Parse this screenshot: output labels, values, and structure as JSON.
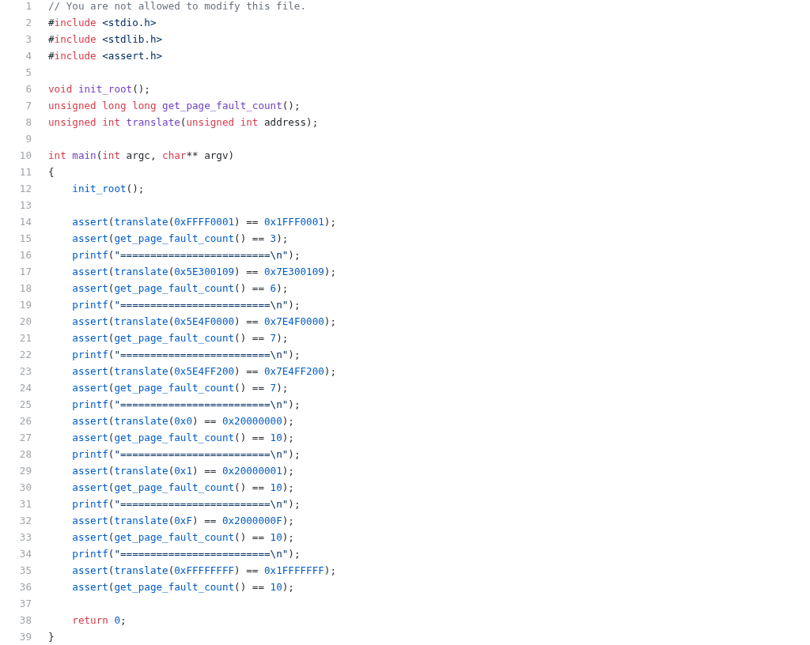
{
  "code_view": {
    "lines": [
      {
        "number": "1",
        "indented": false,
        "tokens": [
          {
            "kind": "comment",
            "text": "// You are not allowed to modify this file."
          }
        ]
      },
      {
        "number": "2",
        "indented": false,
        "tokens": [
          {
            "kind": "plain",
            "text": "#"
          },
          {
            "kind": "keyword",
            "text": "include"
          },
          {
            "kind": "string",
            "text": " <stdio.h>"
          }
        ]
      },
      {
        "number": "3",
        "indented": false,
        "tokens": [
          {
            "kind": "plain",
            "text": "#"
          },
          {
            "kind": "keyword",
            "text": "include"
          },
          {
            "kind": "string",
            "text": " <stdlib.h>"
          }
        ]
      },
      {
        "number": "4",
        "indented": false,
        "tokens": [
          {
            "kind": "plain",
            "text": "#"
          },
          {
            "kind": "keyword",
            "text": "include"
          },
          {
            "kind": "string",
            "text": " <assert.h>"
          }
        ]
      },
      {
        "number": "5"
      },
      {
        "number": "6",
        "indented": false,
        "tokens": [
          {
            "kind": "keyword",
            "text": "void"
          },
          {
            "kind": "function",
            "text": " init_root"
          },
          {
            "kind": "plain",
            "text": "();"
          }
        ]
      },
      {
        "number": "7",
        "indented": false,
        "tokens": [
          {
            "kind": "keyword",
            "text": "unsigned long long"
          },
          {
            "kind": "function",
            "text": " get_page_fault_count"
          },
          {
            "kind": "plain",
            "text": "();"
          }
        ]
      },
      {
        "number": "8",
        "indented": false,
        "tokens": [
          {
            "kind": "keyword",
            "text": "unsigned int"
          },
          {
            "kind": "function",
            "text": " translate"
          },
          {
            "kind": "plain",
            "text": "("
          },
          {
            "kind": "keyword",
            "text": "unsigned int"
          },
          {
            "kind": "plain",
            "text": " address);"
          }
        ]
      },
      {
        "number": "9"
      },
      {
        "number": "10",
        "indented": false,
        "tokens": [
          {
            "kind": "keyword",
            "text": "int"
          },
          {
            "kind": "function",
            "text": " main"
          },
          {
            "kind": "plain",
            "text": "("
          },
          {
            "kind": "keyword",
            "text": "int"
          },
          {
            "kind": "plain",
            "text": " argc, "
          },
          {
            "kind": "keyword",
            "text": "char"
          },
          {
            "kind": "plain",
            "text": "** argv)"
          }
        ]
      },
      {
        "number": "11",
        "indented": false,
        "tokens": [
          {
            "kind": "plain",
            "text": "{"
          }
        ]
      },
      {
        "number": "12",
        "indented": true,
        "tokens": [
          {
            "kind": "call",
            "text": "init_root"
          },
          {
            "kind": "plain",
            "text": "();"
          }
        ]
      },
      {
        "number": "13"
      },
      {
        "number": "14",
        "indented": true,
        "tokens": [
          {
            "kind": "call",
            "text": "assert"
          },
          {
            "kind": "plain",
            "text": "("
          },
          {
            "kind": "call",
            "text": "translate"
          },
          {
            "kind": "plain",
            "text": "("
          },
          {
            "kind": "number",
            "text": "0xFFFF0001"
          },
          {
            "kind": "plain",
            "text": ") == "
          },
          {
            "kind": "number",
            "text": "0x1FFF0001"
          },
          {
            "kind": "plain",
            "text": ");"
          }
        ]
      },
      {
        "number": "15",
        "indented": true,
        "tokens": [
          {
            "kind": "call",
            "text": "assert"
          },
          {
            "kind": "plain",
            "text": "("
          },
          {
            "kind": "call",
            "text": "get_page_fault_count"
          },
          {
            "kind": "plain",
            "text": "() == "
          },
          {
            "kind": "number",
            "text": "3"
          },
          {
            "kind": "plain",
            "text": ");"
          }
        ]
      },
      {
        "number": "16",
        "indented": true,
        "tokens": [
          {
            "kind": "call",
            "text": "printf"
          },
          {
            "kind": "plain",
            "text": "("
          },
          {
            "kind": "string",
            "text": "\"=========================\\n\""
          },
          {
            "kind": "plain",
            "text": ");"
          }
        ]
      },
      {
        "number": "17",
        "indented": true,
        "tokens": [
          {
            "kind": "call",
            "text": "assert"
          },
          {
            "kind": "plain",
            "text": "("
          },
          {
            "kind": "call",
            "text": "translate"
          },
          {
            "kind": "plain",
            "text": "("
          },
          {
            "kind": "number",
            "text": "0x5E300109"
          },
          {
            "kind": "plain",
            "text": ") == "
          },
          {
            "kind": "number",
            "text": "0x7E300109"
          },
          {
            "kind": "plain",
            "text": ");"
          }
        ]
      },
      {
        "number": "18",
        "indented": true,
        "tokens": [
          {
            "kind": "call",
            "text": "assert"
          },
          {
            "kind": "plain",
            "text": "("
          },
          {
            "kind": "call",
            "text": "get_page_fault_count"
          },
          {
            "kind": "plain",
            "text": "() == "
          },
          {
            "kind": "number",
            "text": "6"
          },
          {
            "kind": "plain",
            "text": ");"
          }
        ]
      },
      {
        "number": "19",
        "indented": true,
        "tokens": [
          {
            "kind": "call",
            "text": "printf"
          },
          {
            "kind": "plain",
            "text": "("
          },
          {
            "kind": "string",
            "text": "\"=========================\\n\""
          },
          {
            "kind": "plain",
            "text": ");"
          }
        ]
      },
      {
        "number": "20",
        "indented": true,
        "tokens": [
          {
            "kind": "call",
            "text": "assert"
          },
          {
            "kind": "plain",
            "text": "("
          },
          {
            "kind": "call",
            "text": "translate"
          },
          {
            "kind": "plain",
            "text": "("
          },
          {
            "kind": "number",
            "text": "0x5E4F0000"
          },
          {
            "kind": "plain",
            "text": ") == "
          },
          {
            "kind": "number",
            "text": "0x7E4F0000"
          },
          {
            "kind": "plain",
            "text": ");"
          }
        ]
      },
      {
        "number": "21",
        "indented": true,
        "tokens": [
          {
            "kind": "call",
            "text": "assert"
          },
          {
            "kind": "plain",
            "text": "("
          },
          {
            "kind": "call",
            "text": "get_page_fault_count"
          },
          {
            "kind": "plain",
            "text": "() == "
          },
          {
            "kind": "number",
            "text": "7"
          },
          {
            "kind": "plain",
            "text": ");"
          }
        ]
      },
      {
        "number": "22",
        "indented": true,
        "tokens": [
          {
            "kind": "call",
            "text": "printf"
          },
          {
            "kind": "plain",
            "text": "("
          },
          {
            "kind": "string",
            "text": "\"=========================\\n\""
          },
          {
            "kind": "plain",
            "text": ");"
          }
        ]
      },
      {
        "number": "23",
        "indented": true,
        "tokens": [
          {
            "kind": "call",
            "text": "assert"
          },
          {
            "kind": "plain",
            "text": "("
          },
          {
            "kind": "call",
            "text": "translate"
          },
          {
            "kind": "plain",
            "text": "("
          },
          {
            "kind": "number",
            "text": "0x5E4FF200"
          },
          {
            "kind": "plain",
            "text": ") == "
          },
          {
            "kind": "number",
            "text": "0x7E4FF200"
          },
          {
            "kind": "plain",
            "text": ");"
          }
        ]
      },
      {
        "number": "24",
        "indented": true,
        "tokens": [
          {
            "kind": "call",
            "text": "assert"
          },
          {
            "kind": "plain",
            "text": "("
          },
          {
            "kind": "call",
            "text": "get_page_fault_count"
          },
          {
            "kind": "plain",
            "text": "() == "
          },
          {
            "kind": "number",
            "text": "7"
          },
          {
            "kind": "plain",
            "text": ");"
          }
        ]
      },
      {
        "number": "25",
        "indented": true,
        "tokens": [
          {
            "kind": "call",
            "text": "printf"
          },
          {
            "kind": "plain",
            "text": "("
          },
          {
            "kind": "string",
            "text": "\"=========================\\n\""
          },
          {
            "kind": "plain",
            "text": ");"
          }
        ]
      },
      {
        "number": "26",
        "indented": true,
        "tokens": [
          {
            "kind": "call",
            "text": "assert"
          },
          {
            "kind": "plain",
            "text": "("
          },
          {
            "kind": "call",
            "text": "translate"
          },
          {
            "kind": "plain",
            "text": "("
          },
          {
            "kind": "number",
            "text": "0x0"
          },
          {
            "kind": "plain",
            "text": ") == "
          },
          {
            "kind": "number",
            "text": "0x20000000"
          },
          {
            "kind": "plain",
            "text": ");"
          }
        ]
      },
      {
        "number": "27",
        "indented": true,
        "tokens": [
          {
            "kind": "call",
            "text": "assert"
          },
          {
            "kind": "plain",
            "text": "("
          },
          {
            "kind": "call",
            "text": "get_page_fault_count"
          },
          {
            "kind": "plain",
            "text": "() == "
          },
          {
            "kind": "number",
            "text": "10"
          },
          {
            "kind": "plain",
            "text": ");"
          }
        ]
      },
      {
        "number": "28",
        "indented": true,
        "tokens": [
          {
            "kind": "call",
            "text": "printf"
          },
          {
            "kind": "plain",
            "text": "("
          },
          {
            "kind": "string",
            "text": "\"=========================\\n\""
          },
          {
            "kind": "plain",
            "text": ");"
          }
        ]
      },
      {
        "number": "29",
        "indented": true,
        "tokens": [
          {
            "kind": "call",
            "text": "assert"
          },
          {
            "kind": "plain",
            "text": "("
          },
          {
            "kind": "call",
            "text": "translate"
          },
          {
            "kind": "plain",
            "text": "("
          },
          {
            "kind": "number",
            "text": "0x1"
          },
          {
            "kind": "plain",
            "text": ") == "
          },
          {
            "kind": "number",
            "text": "0x20000001"
          },
          {
            "kind": "plain",
            "text": ");"
          }
        ]
      },
      {
        "number": "30",
        "indented": true,
        "tokens": [
          {
            "kind": "call",
            "text": "assert"
          },
          {
            "kind": "plain",
            "text": "("
          },
          {
            "kind": "call",
            "text": "get_page_fault_count"
          },
          {
            "kind": "plain",
            "text": "() == "
          },
          {
            "kind": "number",
            "text": "10"
          },
          {
            "kind": "plain",
            "text": ");"
          }
        ]
      },
      {
        "number": "31",
        "indented": true,
        "tokens": [
          {
            "kind": "call",
            "text": "printf"
          },
          {
            "kind": "plain",
            "text": "("
          },
          {
            "kind": "string",
            "text": "\"=========================\\n\""
          },
          {
            "kind": "plain",
            "text": ");"
          }
        ]
      },
      {
        "number": "32",
        "indented": true,
        "tokens": [
          {
            "kind": "call",
            "text": "assert"
          },
          {
            "kind": "plain",
            "text": "("
          },
          {
            "kind": "call",
            "text": "translate"
          },
          {
            "kind": "plain",
            "text": "("
          },
          {
            "kind": "number",
            "text": "0xF"
          },
          {
            "kind": "plain",
            "text": ") == "
          },
          {
            "kind": "number",
            "text": "0x2000000F"
          },
          {
            "kind": "plain",
            "text": ");"
          }
        ]
      },
      {
        "number": "33",
        "indented": true,
        "tokens": [
          {
            "kind": "call",
            "text": "assert"
          },
          {
            "kind": "plain",
            "text": "("
          },
          {
            "kind": "call",
            "text": "get_page_fault_count"
          },
          {
            "kind": "plain",
            "text": "() == "
          },
          {
            "kind": "number",
            "text": "10"
          },
          {
            "kind": "plain",
            "text": ");"
          }
        ]
      },
      {
        "number": "34",
        "indented": true,
        "tokens": [
          {
            "kind": "call",
            "text": "printf"
          },
          {
            "kind": "plain",
            "text": "("
          },
          {
            "kind": "string",
            "text": "\"=========================\\n\""
          },
          {
            "kind": "plain",
            "text": ");"
          }
        ]
      },
      {
        "number": "35",
        "indented": true,
        "tokens": [
          {
            "kind": "call",
            "text": "assert"
          },
          {
            "kind": "plain",
            "text": "("
          },
          {
            "kind": "call",
            "text": "translate"
          },
          {
            "kind": "plain",
            "text": "("
          },
          {
            "kind": "number",
            "text": "0xFFFFFFFF"
          },
          {
            "kind": "plain",
            "text": ") == "
          },
          {
            "kind": "number",
            "text": "0x1FFFFFFF"
          },
          {
            "kind": "plain",
            "text": ");"
          }
        ]
      },
      {
        "number": "36",
        "indented": true,
        "tokens": [
          {
            "kind": "call",
            "text": "assert"
          },
          {
            "kind": "plain",
            "text": "("
          },
          {
            "kind": "call",
            "text": "get_page_fault_count"
          },
          {
            "kind": "plain",
            "text": "() == "
          },
          {
            "kind": "number",
            "text": "10"
          },
          {
            "kind": "plain",
            "text": ");"
          }
        ]
      },
      {
        "number": "37"
      },
      {
        "number": "38",
        "indented": true,
        "tokens": [
          {
            "kind": "keyword",
            "text": "return"
          },
          {
            "kind": "number",
            "text": " 0"
          },
          {
            "kind": "plain",
            "text": ";"
          }
        ]
      },
      {
        "number": "39",
        "indented": false,
        "tokens": [
          {
            "kind": "plain",
            "text": "}"
          }
        ]
      }
    ]
  }
}
